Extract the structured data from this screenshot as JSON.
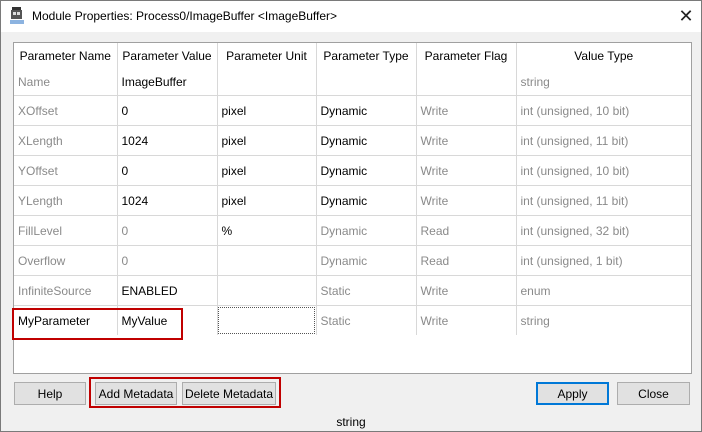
{
  "window": {
    "title": "Module Properties: Process0/ImageBuffer <ImageBuffer>"
  },
  "table": {
    "columns": [
      "Parameter Name",
      "Parameter Value",
      "Parameter Unit",
      "Parameter Type",
      "Parameter Flag",
      "Value Type"
    ],
    "rows": [
      {
        "name": "Name",
        "value": "ImageBuffer",
        "unit": "",
        "type": "",
        "flag": "",
        "vtype": "string"
      },
      {
        "name": "XOffset",
        "value": "0",
        "unit": "pixel",
        "type": "Dynamic",
        "flag": "Write",
        "vtype": "int (unsigned, 10 bit)"
      },
      {
        "name": "XLength",
        "value": "1024",
        "unit": "pixel",
        "type": "Dynamic",
        "flag": "Write",
        "vtype": "int (unsigned, 11 bit)"
      },
      {
        "name": "YOffset",
        "value": "0",
        "unit": "pixel",
        "type": "Dynamic",
        "flag": "Write",
        "vtype": "int (unsigned, 10 bit)"
      },
      {
        "name": "YLength",
        "value": "1024",
        "unit": "pixel",
        "type": "Dynamic",
        "flag": "Write",
        "vtype": "int (unsigned, 11 bit)"
      },
      {
        "name": "FillLevel",
        "value": "0",
        "unit": "%",
        "type": "Dynamic",
        "flag": "Read",
        "vtype": "int (unsigned, 32 bit)"
      },
      {
        "name": "Overflow",
        "value": "0",
        "unit": "",
        "type": "Dynamic",
        "flag": "Read",
        "vtype": "int (unsigned, 1 bit)"
      },
      {
        "name": "InfiniteSource",
        "value": "ENABLED",
        "unit": "",
        "type": "Static",
        "flag": "Write",
        "vtype": "enum"
      },
      {
        "name": "MyParameter",
        "value": "MyValue",
        "unit": "",
        "type": "Static",
        "flag": "Write",
        "vtype": "string"
      }
    ]
  },
  "buttons": {
    "help": "Help",
    "add_metadata": "Add Metadata",
    "delete_metadata": "Delete Metadata",
    "apply": "Apply",
    "close": "Close"
  },
  "status": "string",
  "colors": {
    "highlight": "#c00000",
    "default_button": "#0078d7",
    "disabled_text": "#8a8a8a"
  }
}
